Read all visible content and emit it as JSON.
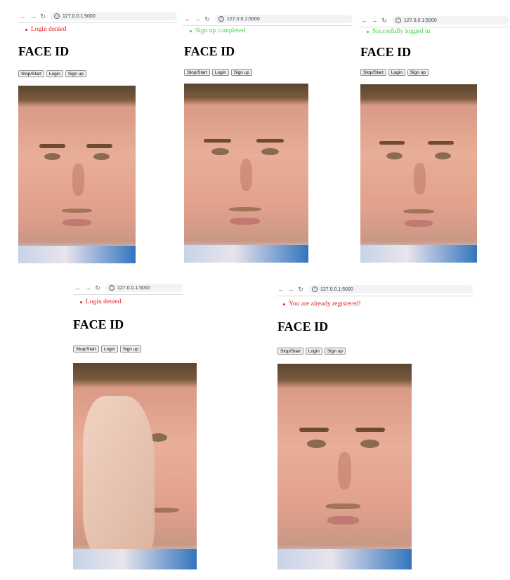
{
  "panels": [
    {
      "url": "127.0.0.1:5000",
      "message": "Login denied",
      "message_color": "#e02020",
      "title": "FACE ID",
      "buttons": {
        "stop_start": "Stop/Start",
        "login": "Login",
        "signup": "Sign up"
      }
    },
    {
      "url": "127.0.0.1:5000",
      "message": "Sign up completed",
      "message_color": "#3cd33c",
      "title": "FACE ID",
      "buttons": {
        "stop_start": "Stop/Start",
        "login": "Login",
        "signup": "Sign up"
      }
    },
    {
      "url": "127.0.0.1:5000",
      "message": "Succesfully logged in",
      "message_color": "#3cd33c",
      "title": "FACE ID",
      "buttons": {
        "stop_start": "Stop/Start",
        "login": "Login",
        "signup": "Sign up"
      }
    },
    {
      "url": "127.0.0.1:5000",
      "message": "Login denied",
      "message_color": "#e02020",
      "title": "FACE ID",
      "buttons": {
        "stop_start": "Stop/Start",
        "login": "Login",
        "signup": "Sign up"
      }
    },
    {
      "url": "127.0.0.1:5000",
      "message": "You are already registered!",
      "message_color": "#e02020",
      "title": "FACE ID",
      "buttons": {
        "stop_start": "Stop/Start",
        "login": "Login",
        "signup": "Sign up"
      }
    }
  ],
  "icons": {
    "back": "back-arrow-icon",
    "forward": "forward-arrow-icon",
    "reload": "reload-icon",
    "info": "info-icon"
  }
}
